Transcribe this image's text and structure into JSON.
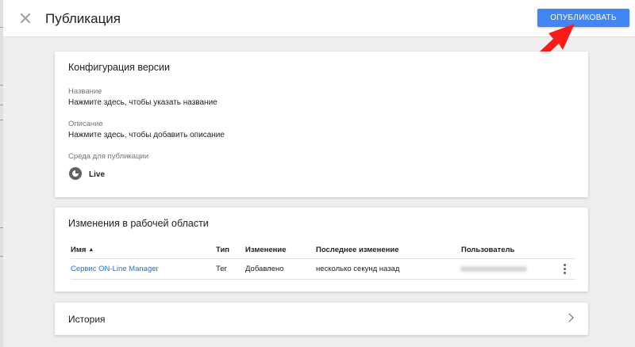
{
  "header": {
    "title": "Публикация",
    "publish_label": "ОПУБЛИКОВАТЬ"
  },
  "version_config": {
    "title": "Конфигурация версии",
    "name_label": "Название",
    "name_placeholder": "Нажмите здесь, чтобы указать название",
    "description_label": "Описание",
    "description_placeholder": "Нажмите здесь, чтобы добавить описание",
    "environment_label": "Среда для публикации",
    "environment_name": "Live"
  },
  "workspace_changes": {
    "title": "Изменения в рабочей области",
    "columns": [
      "Имя",
      "Тип",
      "Изменение",
      "Последнее изменение",
      "Пользователь"
    ],
    "rows": [
      {
        "name": "Сервис ON-Line Manager",
        "type": "Тег",
        "change": "Добавлено",
        "last_change": "несколько секунд назад"
      }
    ]
  },
  "history": {
    "title": "История"
  },
  "colors": {
    "accent": "#4285f4",
    "link": "#1a73e8",
    "arrow": "#ff1a1a"
  },
  "icons": [
    "close-icon",
    "sort-asc-icon",
    "more-vert-icon",
    "chevron-right-icon",
    "environment-icon",
    "pointer-arrow-icon"
  ]
}
